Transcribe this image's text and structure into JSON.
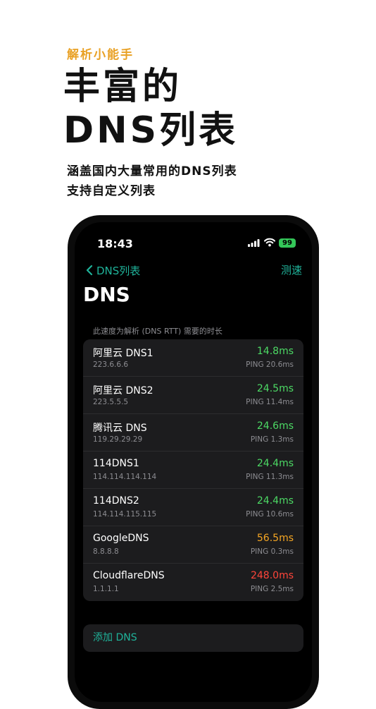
{
  "promo": {
    "tag": "解析小能手",
    "headline_line1": "丰富的",
    "headline_line2": "DNS列表",
    "subhead_line1": "涵盖国内大量常用的DNS列表",
    "subhead_line2": "支持自定义列表"
  },
  "status_bar": {
    "time": "18:43",
    "battery": "99",
    "battery_color": "#34c759"
  },
  "nav": {
    "back_label": "DNS列表",
    "action_label": "测速",
    "accent_color": "#1fb39a"
  },
  "page": {
    "title": "DNS",
    "caption": "此速度为解析 (DNS RTT) 需要的时长"
  },
  "dns_list": [
    {
      "name": "阿里云 DNS1",
      "ip": "223.6.6.6",
      "speed": "14.8ms",
      "ping": "PING 20.6ms",
      "speed_color": "#4cd964"
    },
    {
      "name": "阿里云 DNS2",
      "ip": "223.5.5.5",
      "speed": "24.5ms",
      "ping": "PING 11.4ms",
      "speed_color": "#4cd964"
    },
    {
      "name": "腾讯云 DNS",
      "ip": "119.29.29.29",
      "speed": "24.6ms",
      "ping": "PING 1.3ms",
      "speed_color": "#4cd964"
    },
    {
      "name": "114DNS1",
      "ip": "114.114.114.114",
      "speed": "24.4ms",
      "ping": "PING 11.3ms",
      "speed_color": "#4cd964"
    },
    {
      "name": "114DNS2",
      "ip": "114.114.115.115",
      "speed": "24.4ms",
      "ping": "PING 10.6ms",
      "speed_color": "#4cd964"
    },
    {
      "name": "GoogleDNS",
      "ip": "8.8.8.8",
      "speed": "56.5ms",
      "ping": "PING 0.3ms",
      "speed_color": "#f5a623"
    },
    {
      "name": "CloudflareDNS",
      "ip": "1.1.1.1",
      "speed": "248.0ms",
      "ping": "PING 2.5ms",
      "speed_color": "#ff453a"
    }
  ],
  "add_button": {
    "label": "添加 DNS"
  }
}
